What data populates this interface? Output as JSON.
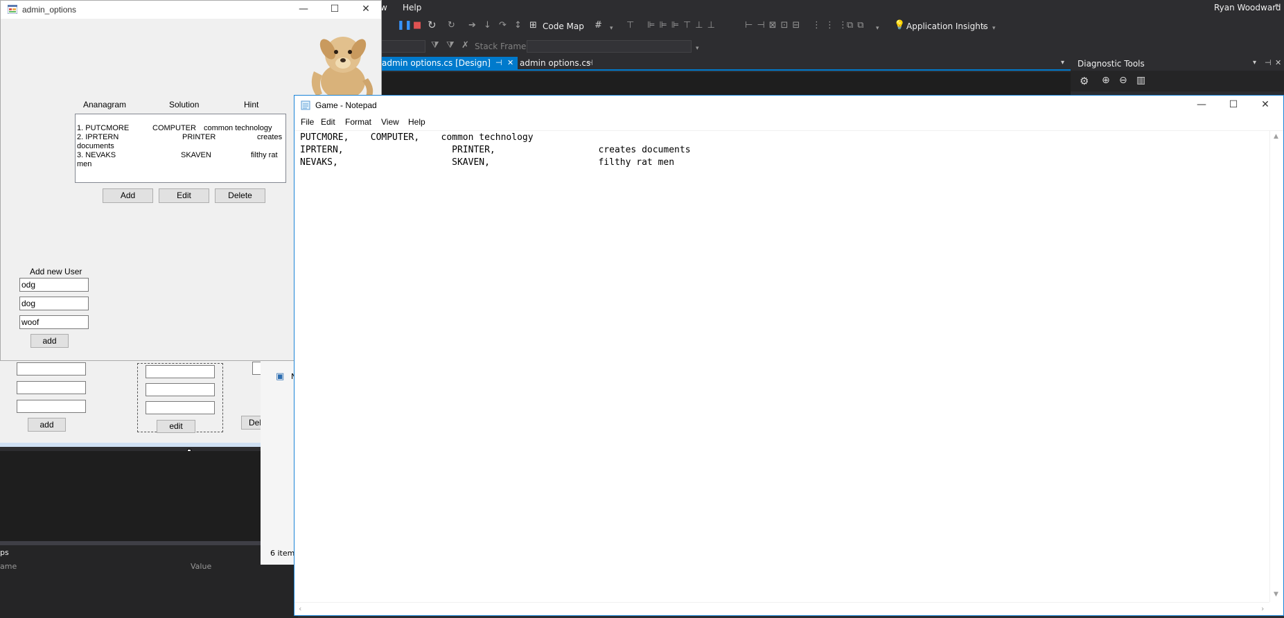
{
  "vs": {
    "menu_help": "Help",
    "menu_w": "w",
    "user_name": "Ryan Woodward",
    "code_map": "Code Map",
    "app_insights": "Application Insights",
    "stack_frame": "Stack Frame:",
    "tabs": [
      {
        "label": "admin options.cs [Design]",
        "pin": "⊣",
        "close": "✕"
      },
      {
        "label": "admin options.cs",
        "pin": "⊣"
      }
    ],
    "diagnostic_tools": "Diagnostic Tools",
    "se_items": "6 item",
    "props_name": "ame",
    "props_value": "Value",
    "props_tab": "ps",
    "designer_edit": "edit",
    "designer_add": "add",
    "designer_del": "Del",
    "se_label": "N"
  },
  "admin": {
    "title": "admin_options",
    "col_anagram": "Ananagram",
    "col_solution": "Solution",
    "col_hint": "Hint",
    "list_lines": [
      {
        "n": "1. PUTCMORE",
        "sol": "COMPUTER",
        "hint": "common technology",
        "wrap": ""
      },
      {
        "n": "2. IPRTERN",
        "sol": "PRINTER",
        "hint": "creates",
        "wrap": "documents"
      },
      {
        "n": "3. NEVAKS",
        "sol": "SKAVEN",
        "hint": "filthy rat",
        "wrap": "men"
      }
    ],
    "btn_add": "Add",
    "btn_edit": "Edit",
    "btn_delete": "Delete",
    "add_user_label": "Add new User",
    "field1": "odg",
    "field2": "dog",
    "field3": "woof",
    "btn_add_user": "add"
  },
  "notepad": {
    "title": "Game - Notepad",
    "menu": [
      "File",
      "Edit",
      "Format",
      "View",
      "Help"
    ],
    "content": "PUTCMORE,    COMPUTER,    common technology\nIPRTERN,                    PRINTER,                   creates documents\nNEVAKS,                     SKAVEN,                    filthy rat men"
  }
}
